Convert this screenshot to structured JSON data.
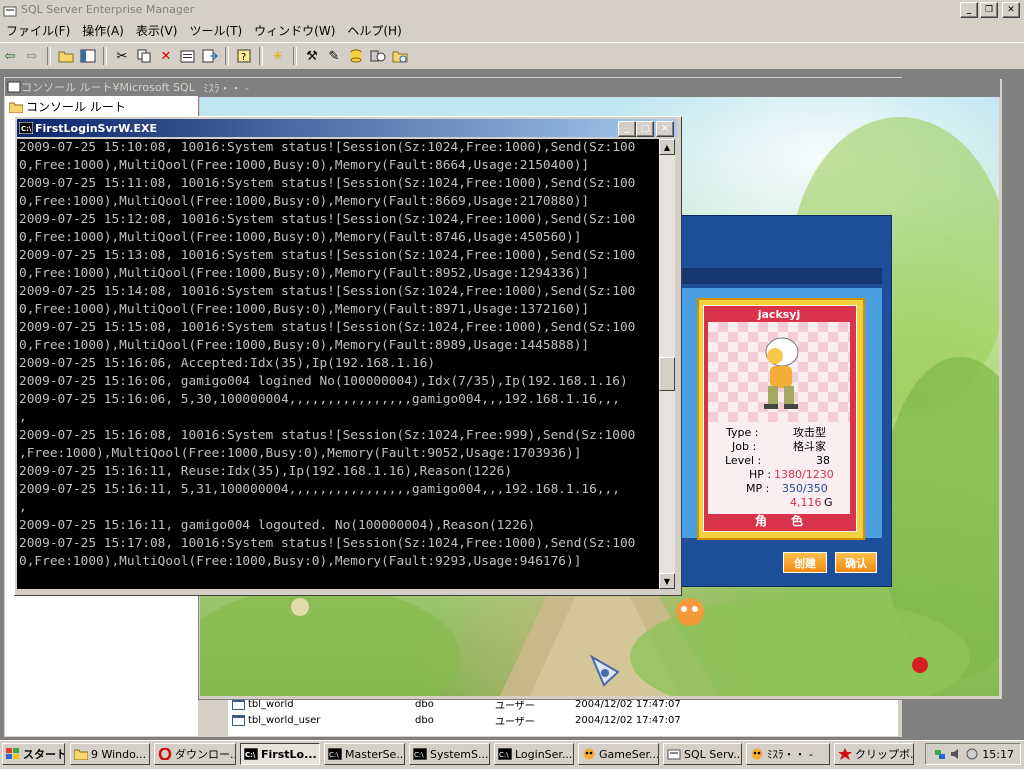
{
  "app": {
    "title": "SQL Server Enterprise Manager",
    "menu": [
      "ファイル(F)",
      "操作(A)",
      "表示(V)",
      "ツール(T)",
      "ウィンドウ(W)",
      "ヘルプ(H)"
    ]
  },
  "console_window": {
    "title": "コンソール ルート¥Microsoft SQL Se",
    "tree_root": "コンソール ルート",
    "rows": [
      {
        "name": "tbl_world",
        "owner": "dbo",
        "type": "ユーザー",
        "created": "2004/12/02 17:47:07"
      },
      {
        "name": "tbl_world_user",
        "owner": "dbo",
        "type": "ユーザー",
        "created": "2004/12/02 17:47:07"
      }
    ]
  },
  "game_window": {
    "title": "ﾐｽﾗ・・ -",
    "character": {
      "name": "jacksyj",
      "type_label": "Type :",
      "type_value": "攻击型",
      "job_label": "Job :",
      "job_value": "格斗家",
      "level_label": "Level :",
      "level_value": "38",
      "hp_label": "HP :",
      "hp_value": "1380/1230",
      "mp_label": "MP :",
      "mp_value": "350/350",
      "gold_value": "4,116",
      "gold_unit": "G",
      "footer": "角　　色"
    },
    "buttons": {
      "create": "创建",
      "confirm": "确认"
    }
  },
  "cmd_window": {
    "title": "FirstLoginSvrW.EXE",
    "lines": [
      "2009-07-25 15:10:08, 10016:System status![Session(Sz:1024,Free:1000),Send(Sz:100",
      "0,Free:1000),MultiQool(Free:1000,Busy:0),Memory(Fault:8664,Usage:2150400)]",
      "2009-07-25 15:11:08, 10016:System status![Session(Sz:1024,Free:1000),Send(Sz:100",
      "0,Free:1000),MultiQool(Free:1000,Busy:0),Memory(Fault:8669,Usage:2170880)]",
      "2009-07-25 15:12:08, 10016:System status![Session(Sz:1024,Free:1000),Send(Sz:100",
      "0,Free:1000),MultiQool(Free:1000,Busy:0),Memory(Fault:8746,Usage:450560)]",
      "2009-07-25 15:13:08, 10016:System status![Session(Sz:1024,Free:1000),Send(Sz:100",
      "0,Free:1000),MultiQool(Free:1000,Busy:0),Memory(Fault:8952,Usage:1294336)]",
      "2009-07-25 15:14:08, 10016:System status![Session(Sz:1024,Free:1000),Send(Sz:100",
      "0,Free:1000),MultiQool(Free:1000,Busy:0),Memory(Fault:8971,Usage:1372160)]",
      "2009-07-25 15:15:08, 10016:System status![Session(Sz:1024,Free:1000),Send(Sz:100",
      "0,Free:1000),MultiQool(Free:1000,Busy:0),Memory(Fault:8989,Usage:1445888)]",
      "2009-07-25 15:16:06, Accepted:Idx(35),Ip(192.168.1.16)",
      "2009-07-25 15:16:06, gamigo004 logined No(100000004),Idx(7/35),Ip(192.168.1.16)",
      "2009-07-25 15:16:06, 5,30,100000004,,,,,,,,,,,,,,,,gamigo004,,,192.168.1.16,,,",
      ",",
      "2009-07-25 15:16:08, 10016:System status![Session(Sz:1024,Free:999),Send(Sz:1000",
      ",Free:1000),MultiQool(Free:1000,Busy:0),Memory(Fault:9052,Usage:1703936)]",
      "2009-07-25 15:16:11, Reuse:Idx(35),Ip(192.168.1.16),Reason(1226)",
      "2009-07-25 15:16:11, 5,31,100000004,,,,,,,,,,,,,,,,gamigo004,,,192.168.1.16,,,",
      ",",
      "2009-07-25 15:16:11, gamigo004 logouted. No(100000004),Reason(1226)",
      "2009-07-25 15:17:08, 10016:System status![Session(Sz:1024,Free:1000),Send(Sz:100",
      "0,Free:1000),MultiQool(Free:1000,Busy:0),Memory(Fault:9293,Usage:946176)]",
      ""
    ]
  },
  "taskbar": {
    "start": "スタート",
    "items": [
      {
        "label": "9 Windo...",
        "icon": "folder-icon"
      },
      {
        "label": "ダウンロー...",
        "icon": "opera-icon"
      },
      {
        "label": "FirstLo...",
        "icon": "console-icon",
        "active": true
      },
      {
        "label": "MasterSe...",
        "icon": "console-icon"
      },
      {
        "label": "SystemS...",
        "icon": "console-icon"
      },
      {
        "label": "LoginSer...",
        "icon": "console-icon"
      },
      {
        "label": "GameSer...",
        "icon": "game-icon"
      },
      {
        "label": "SQL Serv...",
        "icon": "sql-icon"
      },
      {
        "label": "ﾐｽﾗ・・ -",
        "icon": "game-icon"
      },
      {
        "label": "クリップボ...",
        "icon": "clipboard-icon"
      }
    ],
    "clock": "15:17"
  },
  "colors": {
    "titlebar_active": "#0a246a",
    "console_bg": "#000000",
    "console_text": "#c0c0c0",
    "card_red": "#d8334a",
    "panel_blue": "#1e4f9a"
  }
}
